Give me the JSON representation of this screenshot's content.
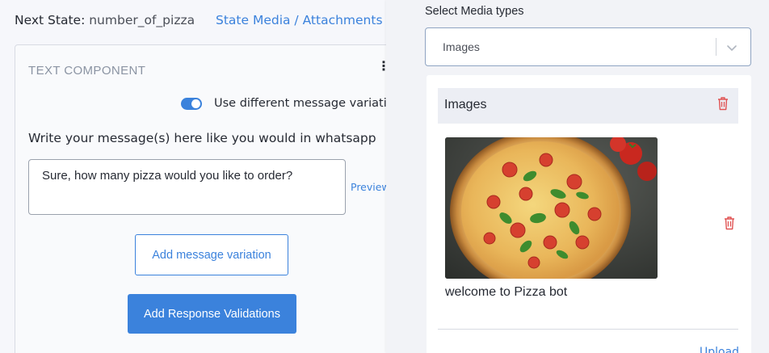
{
  "left": {
    "next_state_label": "Next State:",
    "next_state_value": "number_of_pizza",
    "media_link": "State Media / Attachments",
    "component": {
      "title": "TEXT COMPONENT",
      "menu_icon": "⋮",
      "toggle_on": true,
      "toggle_label": "Use different message variation",
      "write_label": "Write your message(s) here like you would in whatsapp",
      "message": "Sure, how many pizza would you like to order?",
      "preview_label": "Preview",
      "add_variation_button": "Add message variation",
      "add_validations_button": "Add Response Validations"
    }
  },
  "right": {
    "select_label": "Select Media types",
    "select_value": "Images",
    "section_title": "Images",
    "image_caption": "welcome to Pizza bot",
    "upload_link": "Upload"
  },
  "colors": {
    "accent": "#3b82dc",
    "danger": "#e05252"
  }
}
